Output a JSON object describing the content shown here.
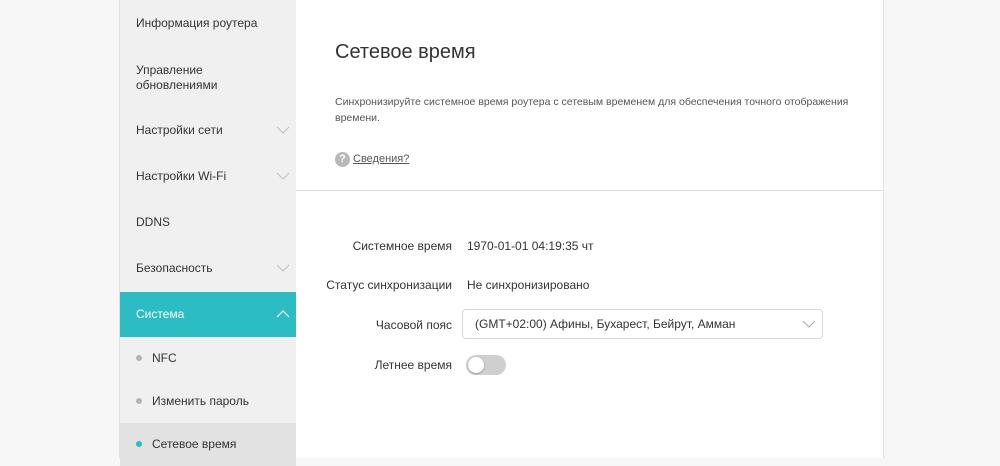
{
  "sidebar": {
    "items": [
      {
        "label": "Информация роутера"
      },
      {
        "label": "Управление обновлениями"
      },
      {
        "label": "Настройки сети"
      },
      {
        "label": "Настройки Wi-Fi"
      },
      {
        "label": "DDNS"
      },
      {
        "label": "Безопасность"
      },
      {
        "label": "Система"
      }
    ],
    "subitems": [
      {
        "label": "NFC"
      },
      {
        "label": "Изменить пароль"
      },
      {
        "label": "Сетевое время"
      }
    ],
    "active_color": "#2bbcc4"
  },
  "main": {
    "title": "Сетевое время",
    "description": "Синхронизируйте системное время роутера с сетевым временем для обеспечения точного отображения времени.",
    "help_link": "Сведения?",
    "system_time_label": "Системное время",
    "system_time_value": "1970-01-01 04:19:35 чт",
    "sync_status_label": "Статус синхронизации",
    "sync_status_value": "Не синхронизировано",
    "timezone_label": "Часовой пояс",
    "timezone_value": "(GMT+02:00) Афины, Бухарест, Бейрут, Амман",
    "dst_label": "Летнее время",
    "dst_enabled": false
  }
}
